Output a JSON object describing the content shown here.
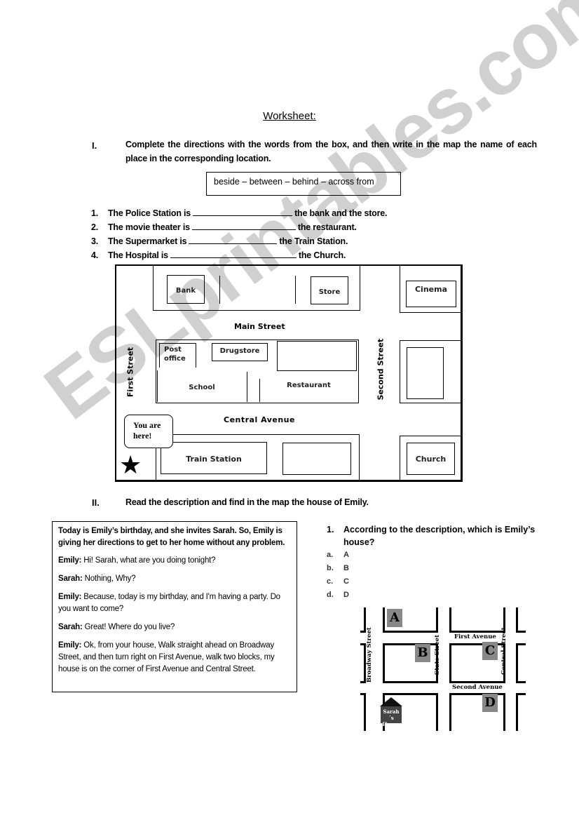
{
  "title": "Worksheet:",
  "section1": {
    "number": "I.",
    "instruction": "Complete the directions with the words from the box, and then write in the map the name of each place in the corresponding location.",
    "word_box": "beside – between – behind – across from",
    "questions": [
      {
        "num": "1.",
        "before": "The Police Station is",
        "after": "the bank and the store."
      },
      {
        "num": "2.",
        "before": "The movie theater is",
        "after": "the restaurant."
      },
      {
        "num": "3.",
        "before": "The Supermarket is",
        "after": "the Train Station."
      },
      {
        "num": "4.",
        "before": "The Hospital is",
        "after": "the Church."
      }
    ],
    "map": {
      "places": {
        "bank": "Bank",
        "store": "Store",
        "cinema": "Cinema",
        "post_office_1": "Post",
        "post_office_2": "office",
        "drugstore": "Drugstore",
        "school": "School",
        "restaurant": "Restaurant",
        "train_station": "Train Station",
        "church": "Church"
      },
      "streets": {
        "main": "Main Street",
        "central": "Central Avenue",
        "first": "First Street",
        "second": "Second Street"
      },
      "bubble_1": "You are",
      "bubble_2": "here!",
      "star": "★"
    }
  },
  "section2": {
    "number": "II.",
    "instruction": "Read the description and find in the map the house of Emily.",
    "intro": "Today is Emily’s birthday, and she invites Sarah.  So, Emily is giving her directions to get to her home without any problem.",
    "dialog": [
      {
        "speaker": "Emily:",
        "text": "  Hi! Sarah, what are you doing tonight?"
      },
      {
        "speaker": "Sarah:",
        "text": " Nothing, Why?"
      },
      {
        "speaker": "Emily:",
        "text": " Because, today is my birthday, and I'm having a party. Do you want to come?"
      },
      {
        "speaker": "Sarah:",
        "text": " Great! Where do you live?"
      },
      {
        "speaker": "Emily:",
        "text": " Ok, from your house, Walk straight ahead on Broadway Street, and then turn right on First Avenue, walk two blocks, my house is on the corner of First Avenue and Central Street."
      }
    ],
    "question": {
      "num": "1.",
      "text": "According to the description, which is Emily’s house?",
      "options": [
        {
          "letter": "a.",
          "value": "A"
        },
        {
          "letter": "b.",
          "value": "B"
        },
        {
          "letter": "c.",
          "value": "C"
        },
        {
          "letter": "d.",
          "value": "D"
        }
      ]
    },
    "small_map": {
      "letters": [
        "A",
        "B",
        "C",
        "D"
      ],
      "streets": {
        "first_ave": "First Avenue",
        "second_ave": "Second Avenue",
        "broadway": "Broadway Street",
        "state": "State Street",
        "central": "Central Street"
      },
      "house_1": "Sarah´s",
      "house_2": "House"
    }
  },
  "watermark": "ESLprintables.com"
}
